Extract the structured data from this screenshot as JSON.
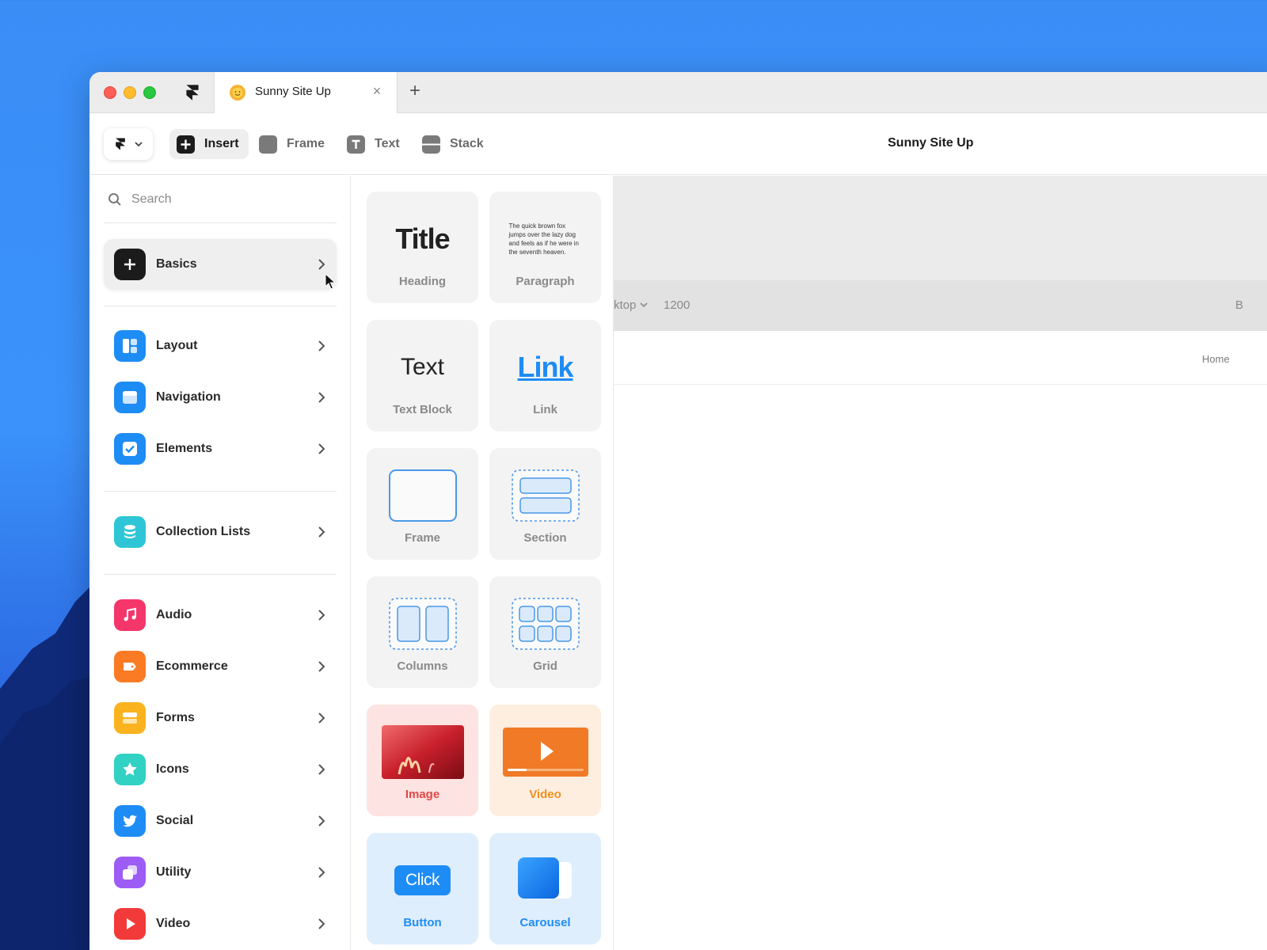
{
  "tab": {
    "title": "Sunny Site Up",
    "close": "×",
    "add": "+"
  },
  "toolbar": {
    "insert_label": "Insert",
    "frame_label": "Frame",
    "text_label": "Text",
    "stack_label": "Stack",
    "doc_title": "Sunny Site Up"
  },
  "sidebar": {
    "search_placeholder": "Search",
    "categories": [
      {
        "label": "Basics",
        "icon": "plus-icon",
        "color": "#1b1b1b",
        "active": true
      },
      {
        "label": "Layout",
        "icon": "layout-icon",
        "color": "#1e8cf5"
      },
      {
        "label": "Navigation",
        "icon": "navigation-icon",
        "color": "#1e8cf5"
      },
      {
        "label": "Elements",
        "icon": "checkbox-icon",
        "color": "#1e8cf5"
      },
      {
        "label": "Collection Lists",
        "icon": "database-icon",
        "color": "#2ec6d6"
      },
      {
        "label": "Audio",
        "icon": "music-note-icon",
        "color": "#f5366b"
      },
      {
        "label": "Ecommerce",
        "icon": "tag-icon",
        "color": "#fb7a24"
      },
      {
        "label": "Forms",
        "icon": "form-icon",
        "color": "#fbb21f"
      },
      {
        "label": "Icons",
        "icon": "star-icon",
        "color": "#31d1c3"
      },
      {
        "label": "Social",
        "icon": "twitter-icon",
        "color": "#1e8cf5"
      },
      {
        "label": "Utility",
        "icon": "utility-icon",
        "color": "#9d5cf5"
      },
      {
        "label": "Video",
        "icon": "play-icon",
        "color": "#f23a3a"
      }
    ]
  },
  "panel": {
    "cards": [
      {
        "label": "Heading",
        "preview_text": "Title"
      },
      {
        "label": "Paragraph",
        "preview_text": "The quick brown fox jumps over the lazy dog and feels as if he were in the seventh heaven."
      },
      {
        "label": "Text Block",
        "preview_text": "Text"
      },
      {
        "label": "Link",
        "preview_text": "Link"
      },
      {
        "label": "Frame"
      },
      {
        "label": "Section"
      },
      {
        "label": "Columns"
      },
      {
        "label": "Grid"
      },
      {
        "label": "Image"
      },
      {
        "label": "Video"
      },
      {
        "label": "Button",
        "preview_text": "Click"
      },
      {
        "label": "Carousel"
      }
    ]
  },
  "canvas": {
    "breakpoint_name": "ktop",
    "breakpoint_width": "1200",
    "right_label": "B",
    "nav_link": "Home"
  },
  "colors": {
    "accent": "#1e8cf5",
    "image_card": "#fde3e1",
    "video_card": "#fdeee0",
    "button_card": "#dfeefc"
  }
}
